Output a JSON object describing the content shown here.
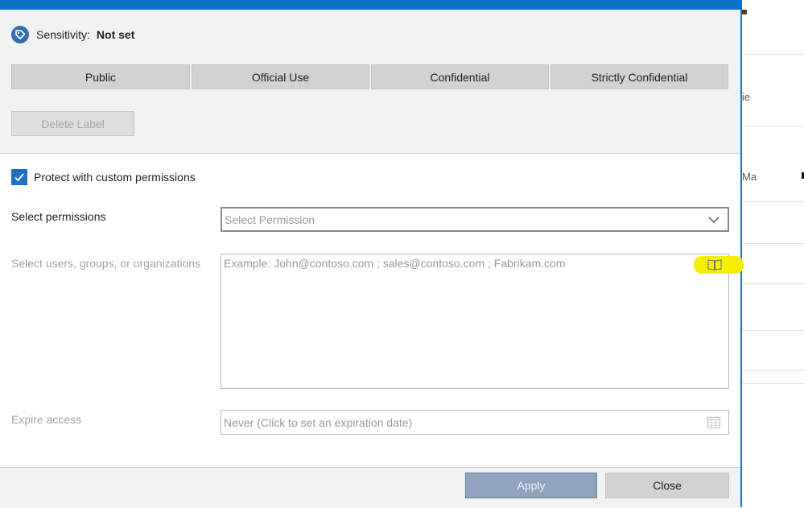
{
  "sensitivity": {
    "label": "Sensitivity:",
    "value": "Not set"
  },
  "labels": [
    "Public",
    "Official Use",
    "Confidential",
    "Strictly Confidential"
  ],
  "delete_label": "Delete Label",
  "protect": {
    "label": "Protect with custom permissions",
    "checked": true
  },
  "permissions": {
    "label": "Select permissions",
    "placeholder": "Select Permission"
  },
  "users": {
    "label": "Select users, groups, or organizations",
    "placeholder": "Example: John@contoso.com ; sales@contoso.com ; Fabrikam.com"
  },
  "expire": {
    "label": "Expire access",
    "placeholder": "Never (Click to set an expiration date)"
  },
  "footer": {
    "apply": "Apply",
    "close": "Close"
  },
  "background": {
    "fragments": [
      "ie",
      "Ma"
    ]
  },
  "colors": {
    "accent": "#0a72c6",
    "checkbox": "#1e6fc7",
    "highlight": "#f5f000",
    "apply_disabled": "#8fa3bd"
  },
  "icons": {
    "sensitivity": "tag-icon",
    "address_book": "address-book-icon",
    "calendar": "calendar-icon",
    "dropdown": "chevron-down-icon",
    "check": "checkmark-icon"
  }
}
